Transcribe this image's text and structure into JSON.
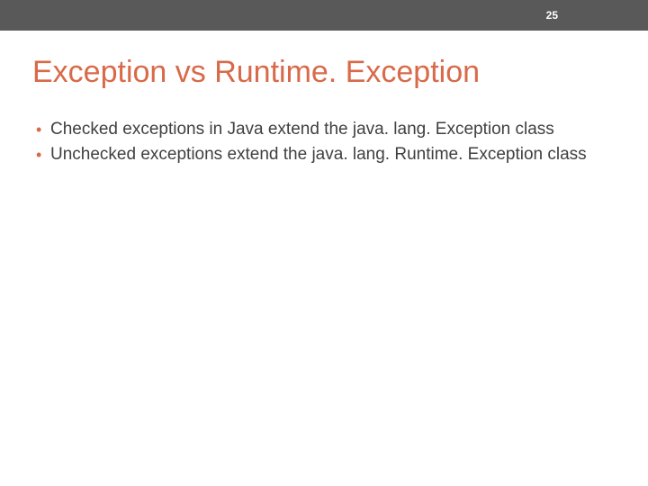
{
  "header": {
    "page_number": "25"
  },
  "title": "Exception vs Runtime. Exception",
  "bullets": [
    "Checked exceptions in Java extend the java. lang. Exception class",
    "Unchecked exceptions extend the java. lang. Runtime. Exception class"
  ]
}
